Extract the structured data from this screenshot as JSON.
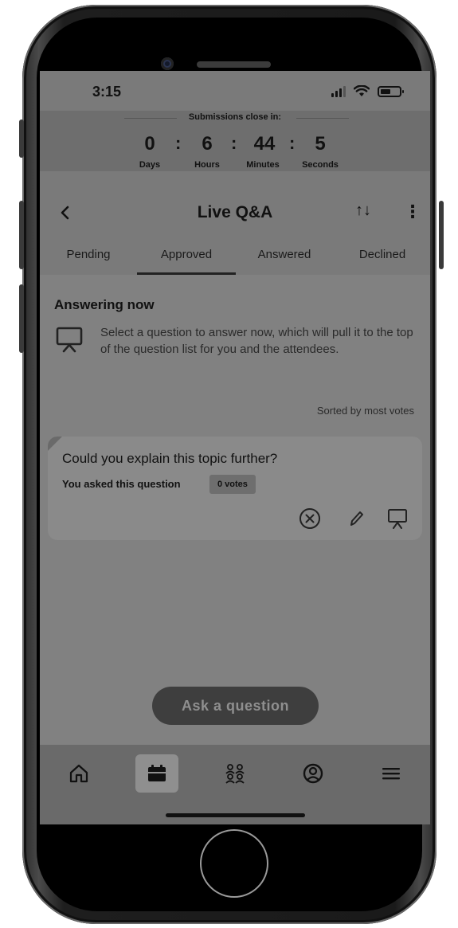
{
  "status_bar": {
    "time": "3:15"
  },
  "countdown": {
    "title": "Submissions close in:",
    "days": "0",
    "hours": "6",
    "minutes": "44",
    "seconds": "5",
    "days_label": "Days",
    "hours_label": "Hours",
    "minutes_label": "Minutes",
    "seconds_label": "Seconds",
    "separator": ":"
  },
  "header": {
    "back_icon": "‹",
    "title": "Live Q&A",
    "sort_icon": "↑↓",
    "more_icon": "⋮"
  },
  "tabs": [
    {
      "label": "Pending",
      "active": false
    },
    {
      "label": "Approved",
      "active": true
    },
    {
      "label": "Answered",
      "active": false
    },
    {
      "label": "Declined",
      "active": false
    }
  ],
  "answering_now": {
    "title": "Answering now",
    "icon": "presentation-icon",
    "hint": "Select a question to answer now, which will pull it to the top of the question list for you and the attendees."
  },
  "sort_note": "Sorted by most votes",
  "question_card": {
    "question": "Could you explain this topic further?",
    "meta": "You asked this question",
    "votes": "0 votes",
    "actions": [
      "decline-icon",
      "edit-icon",
      "present-icon"
    ]
  },
  "ask_button": {
    "label": "Ask a question"
  },
  "bottom_nav": {
    "items": [
      {
        "icon": "home-icon",
        "active": false
      },
      {
        "icon": "agenda-icon",
        "active": true
      },
      {
        "icon": "attendees-icon",
        "active": false
      },
      {
        "icon": "profile-icon",
        "active": false
      },
      {
        "icon": "menu-icon",
        "active": false
      }
    ]
  },
  "colors": {
    "overlay": "#7a7a7a",
    "text": "#111111",
    "ask_button_bg": "#3e3e3e"
  }
}
